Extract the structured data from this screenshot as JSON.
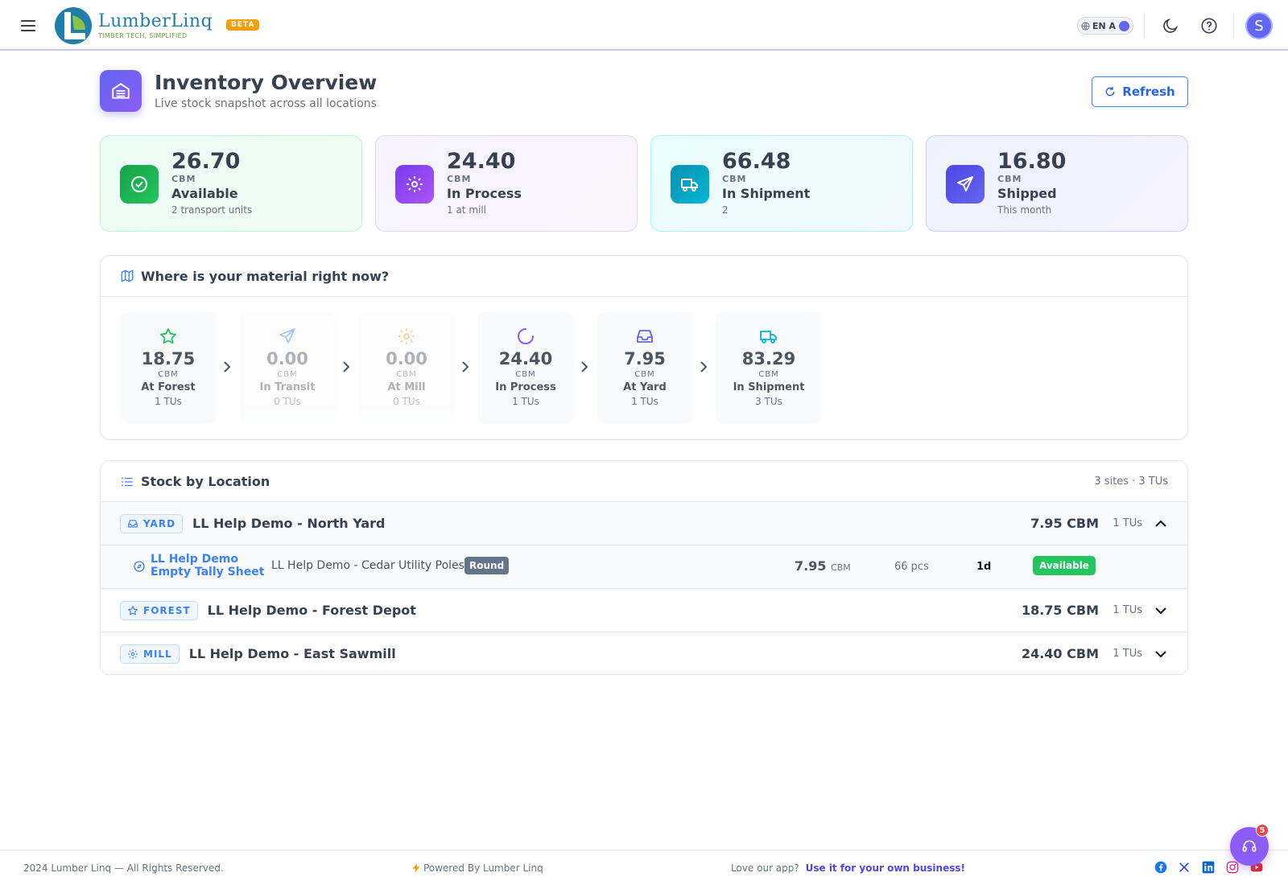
{
  "header": {
    "logo_name": "LumberLinq",
    "logo_tagline": "TIMBER TECH, SIMPLIFIED",
    "beta_badge": "BETA",
    "language_toggle": "EN A",
    "avatar_initial": "S"
  },
  "page": {
    "title": "Inventory Overview",
    "subtitle": "Live stock snapshot across all locations",
    "refresh_label": "Refresh"
  },
  "stats": [
    {
      "value": "26.70",
      "unit": "CBM",
      "label": "Available",
      "sub": "2 transport units",
      "icon": "check-circle-icon",
      "color": "#22c55e"
    },
    {
      "value": "24.40",
      "unit": "CBM",
      "label": "In Process",
      "sub": "1 at mill",
      "icon": "gear-icon",
      "color": "#8b5cf6"
    },
    {
      "value": "66.48",
      "unit": "CBM",
      "label": "In Shipment",
      "sub": "2",
      "icon": "truck-icon",
      "color": "#06b6d4"
    },
    {
      "value": "16.80",
      "unit": "CBM",
      "label": "Shipped",
      "sub": "This month",
      "icon": "send-icon",
      "color": "#6366f1"
    }
  ],
  "material_flow": {
    "heading": "Where is your material right now?",
    "stages": [
      {
        "value": "18.75",
        "unit": "CBM",
        "label": "At Forest",
        "tus": "1 TUs",
        "icon": "star-icon"
      },
      {
        "value": "0.00",
        "unit": "CBM",
        "label": "In Transit",
        "tus": "0 TUs",
        "icon": "send-icon"
      },
      {
        "value": "0.00",
        "unit": "CBM",
        "label": "At Mill",
        "tus": "0 TUs",
        "icon": "gear-icon"
      },
      {
        "value": "24.40",
        "unit": "CBM",
        "label": "In Process",
        "tus": "1 TUs",
        "icon": "loader-icon"
      },
      {
        "value": "7.95",
        "unit": "CBM",
        "label": "At Yard",
        "tus": "1 TUs",
        "icon": "inbox-icon"
      },
      {
        "value": "83.29",
        "unit": "CBM",
        "label": "In Shipment",
        "tus": "3 TUs",
        "icon": "truck-icon"
      }
    ]
  },
  "stock_by_location": {
    "heading": "Stock by Location",
    "meta": "3 sites · 3 TUs",
    "locations": [
      {
        "type": "YARD",
        "name": "LL Help Demo - North Yard",
        "cbm": "7.95 CBM",
        "tus": "1 TUs",
        "expanded": true
      },
      {
        "type": "FOREST",
        "name": "LL Help Demo - Forest Depot",
        "cbm": "18.75 CBM",
        "tus": "1 TUs",
        "expanded": false
      },
      {
        "type": "MILL",
        "name": "LL Help Demo - East Sawmill",
        "cbm": "24.40 CBM",
        "tus": "1 TUs",
        "expanded": false
      }
    ],
    "item": {
      "tally_line1": "LL Help Demo",
      "tally_line2": "Empty Tally Sheet",
      "product": "LL Help Demo - Cedar Utility Poles",
      "shape": "Round",
      "cbm": "7.95",
      "cbm_unit": "CBM",
      "pcs": "66 pcs",
      "age": "1d",
      "status": "Available"
    }
  },
  "footer": {
    "copyright": "2024 Lumber Linq — All Rights Reserved.",
    "powered": "Powered By Lumber Linq",
    "love": "Love our app?",
    "cta": "Use it for your own business!",
    "support_count": "5"
  }
}
